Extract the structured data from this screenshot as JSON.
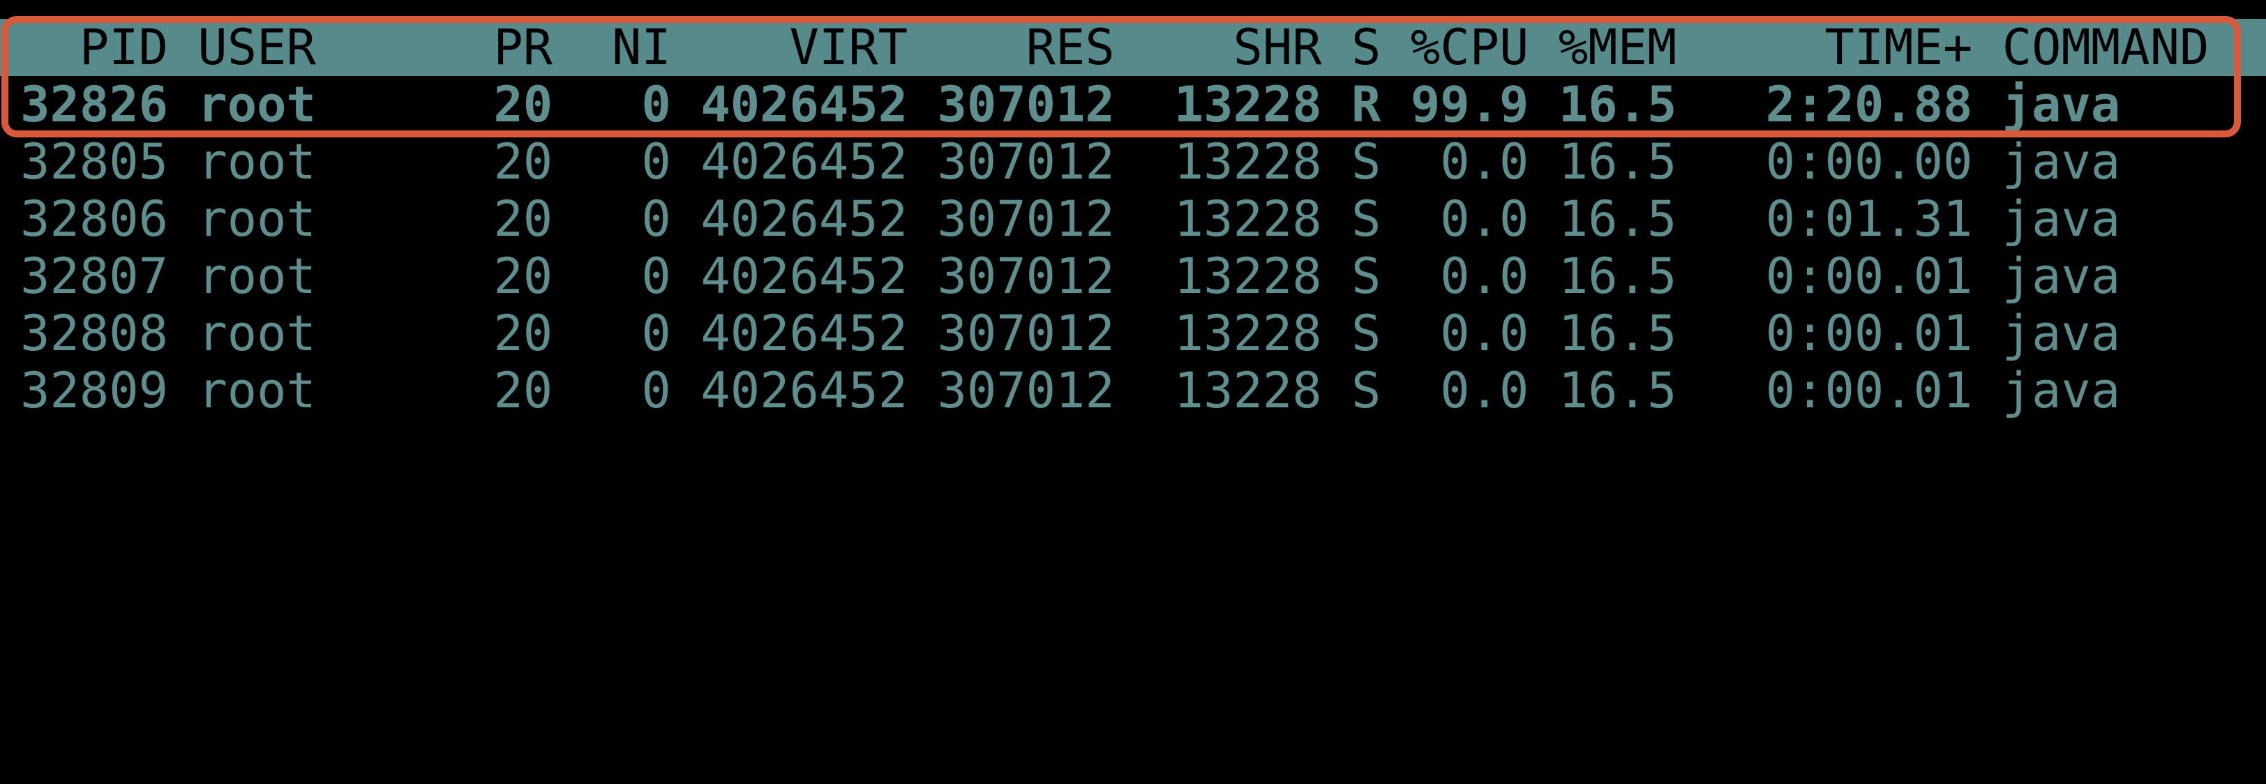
{
  "app": "top",
  "colors": {
    "header_bg": "#578b8b",
    "header_text": "#000000",
    "row_text": "#5e8e8e",
    "background": "#000000",
    "highlight_border": "#d95a3a"
  },
  "columns": [
    {
      "key": "pid",
      "label": "PID",
      "align": "right"
    },
    {
      "key": "user",
      "label": "USER",
      "align": "left"
    },
    {
      "key": "pr",
      "label": "PR",
      "align": "right"
    },
    {
      "key": "ni",
      "label": "NI",
      "align": "right"
    },
    {
      "key": "virt",
      "label": "VIRT",
      "align": "right"
    },
    {
      "key": "res",
      "label": "RES",
      "align": "right"
    },
    {
      "key": "shr",
      "label": "SHR",
      "align": "right"
    },
    {
      "key": "s",
      "label": "S",
      "align": "left"
    },
    {
      "key": "cpu",
      "label": "%CPU",
      "align": "right"
    },
    {
      "key": "mem",
      "label": "%MEM",
      "align": "right"
    },
    {
      "key": "time",
      "label": "TIME+",
      "align": "right"
    },
    {
      "key": "command",
      "label": "COMMAND",
      "align": "left"
    }
  ],
  "rows": [
    {
      "pid": "32826",
      "user": "root",
      "pr": "20",
      "ni": "0",
      "virt": "4026452",
      "res": "307012",
      "shr": "13228",
      "s": "R",
      "cpu": "99.9",
      "mem": "16.5",
      "time": "2:20.88",
      "command": "java",
      "bold": true,
      "highlighted": true
    },
    {
      "pid": "32805",
      "user": "root",
      "pr": "20",
      "ni": "0",
      "virt": "4026452",
      "res": "307012",
      "shr": "13228",
      "s": "S",
      "cpu": "0.0",
      "mem": "16.5",
      "time": "0:00.00",
      "command": "java"
    },
    {
      "pid": "32806",
      "user": "root",
      "pr": "20",
      "ni": "0",
      "virt": "4026452",
      "res": "307012",
      "shr": "13228",
      "s": "S",
      "cpu": "0.0",
      "mem": "16.5",
      "time": "0:01.31",
      "command": "java"
    },
    {
      "pid": "32807",
      "user": "root",
      "pr": "20",
      "ni": "0",
      "virt": "4026452",
      "res": "307012",
      "shr": "13228",
      "s": "S",
      "cpu": "0.0",
      "mem": "16.5",
      "time": "0:00.01",
      "command": "java"
    },
    {
      "pid": "32808",
      "user": "root",
      "pr": "20",
      "ni": "0",
      "virt": "4026452",
      "res": "307012",
      "shr": "13228",
      "s": "S",
      "cpu": "0.0",
      "mem": "16.5",
      "time": "0:00.01",
      "command": "java"
    },
    {
      "pid": "32809",
      "user": "root",
      "pr": "20",
      "ni": "0",
      "virt": "4026452",
      "res": "307012",
      "shr": "13228",
      "s": "S",
      "cpu": "0.0",
      "mem": "16.5",
      "time": "0:00.01",
      "command": "java"
    }
  ]
}
